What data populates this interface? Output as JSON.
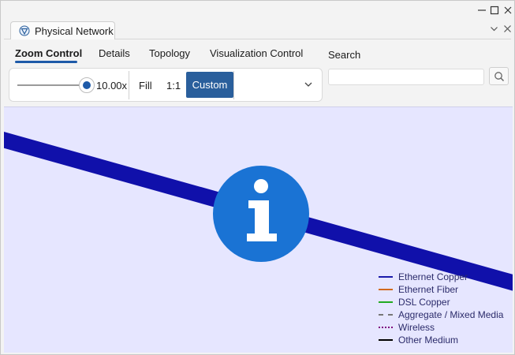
{
  "window": {
    "controls": {
      "minimize": "—",
      "maximize": "□",
      "close": "✕"
    },
    "doc_tab": {
      "label": "Physical Network",
      "icon": "network-logo-icon"
    },
    "tab_actions": {
      "expand_icon": "chevron-down-icon",
      "close": "✕"
    }
  },
  "ribbon": {
    "tabs": [
      {
        "label": "Zoom Control",
        "active": true
      },
      {
        "label": "Details",
        "active": false
      },
      {
        "label": "Topology",
        "active": false
      },
      {
        "label": "Visualization Control",
        "active": false
      }
    ],
    "zoom": {
      "slider_level": 1.0,
      "value_label": "10.00x",
      "fill_label": "Fill",
      "one_to_one_label": "1:1",
      "custom_label": "Custom",
      "accent": "#2a5f9c"
    },
    "search": {
      "label": "Search",
      "value": "",
      "icon": "search-icon"
    }
  },
  "canvas": {
    "background": "#e6e6ff",
    "link_color": "#1010aa",
    "info_icon_color": "#1a73d4",
    "legend": [
      {
        "label": "Ethernet Copper",
        "color": "#1a1aaa",
        "style": "solid"
      },
      {
        "label": "Ethernet Fiber",
        "color": "#d2691e",
        "style": "solid"
      },
      {
        "label": "DSL Copper",
        "color": "#22aa22",
        "style": "solid"
      },
      {
        "label": "Aggregate / Mixed Media",
        "color": "#777777",
        "style": "dashed"
      },
      {
        "label": "Wireless",
        "color": "#800080",
        "style": "dotted"
      },
      {
        "label": "Other Medium",
        "color": "#000000",
        "style": "solid"
      }
    ]
  }
}
